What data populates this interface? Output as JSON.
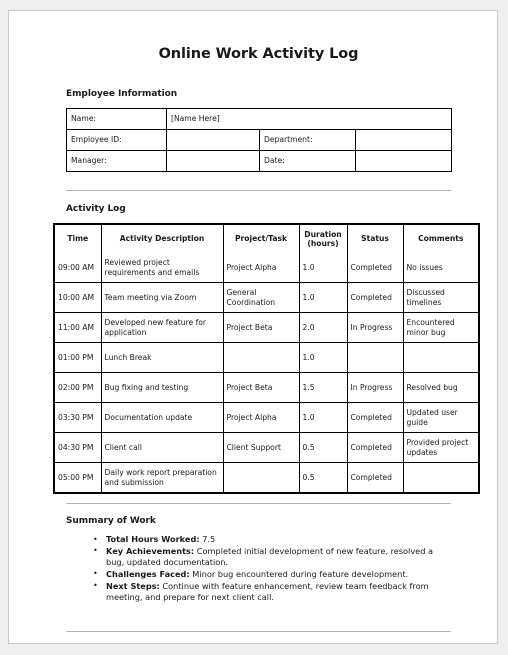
{
  "document": {
    "title": "Online Work Activity Log"
  },
  "employee_information": {
    "heading": "Employee Information",
    "rows": [
      {
        "label": "Name:",
        "value": "[Name Here]",
        "label2": "",
        "value2": ""
      },
      {
        "label": "Employee ID:",
        "value": "",
        "label2": "Department:",
        "value2": ""
      },
      {
        "label": "Manager:",
        "value": "",
        "label2": "Date:",
        "value2": ""
      }
    ]
  },
  "activity_log": {
    "heading": "Activity Log",
    "columns": [
      "Time",
      "Activity Description",
      "Project/Task",
      "Duration (hours)",
      "Status",
      "Comments"
    ],
    "column_duration_line1": "Duration",
    "column_duration_line2": "(hours)",
    "rows": [
      {
        "time": "09:00 AM",
        "description": "Reviewed project requirements and emails",
        "project": "Project Alpha",
        "duration": "1.0",
        "status": "Completed",
        "comments": "No issues"
      },
      {
        "time": "10:00 AM",
        "description": "Team meeting via Zoom",
        "project": "General Coordination",
        "duration": "1.0",
        "status": "Completed",
        "comments": "Discussed timelines"
      },
      {
        "time": "11:00 AM",
        "description": "Developed new feature for application",
        "project": "Project Beta",
        "duration": "2.0",
        "status": "In Progress",
        "comments": "Encountered minor bug"
      },
      {
        "time": "01:00 PM",
        "description": "Lunch Break",
        "project": "",
        "duration": "1.0",
        "status": "",
        "comments": ""
      },
      {
        "time": "02:00 PM",
        "description": "Bug fixing and testing",
        "project": "Project Beta",
        "duration": "1.5",
        "status": "In Progress",
        "comments": "Resolved bug"
      },
      {
        "time": "03:30 PM",
        "description": "Documentation update",
        "project": "Project Alpha",
        "duration": "1.0",
        "status": "Completed",
        "comments": "Updated user guide"
      },
      {
        "time": "04:30 PM",
        "description": "Client call",
        "project": "Client Support",
        "duration": "0.5",
        "status": "Completed",
        "comments": "Provided project updates"
      },
      {
        "time": "05:00 PM",
        "description": "Daily work report preparation and submission",
        "project": "",
        "duration": "0.5",
        "status": "Completed",
        "comments": ""
      }
    ]
  },
  "summary": {
    "heading": "Summary of Work",
    "items": [
      {
        "label": "Total Hours Worked:",
        "text": " 7.5"
      },
      {
        "label": "Key Achievements:",
        "text": " Completed initial development of new feature, resolved a bug, updated documentation."
      },
      {
        "label": "Challenges Faced:",
        "text": " Minor bug encountered during feature development."
      },
      {
        "label": "Next Steps:",
        "text": " Continue with feature enhancement, review team feedback from meeting, and prepare for next client call."
      }
    ]
  }
}
